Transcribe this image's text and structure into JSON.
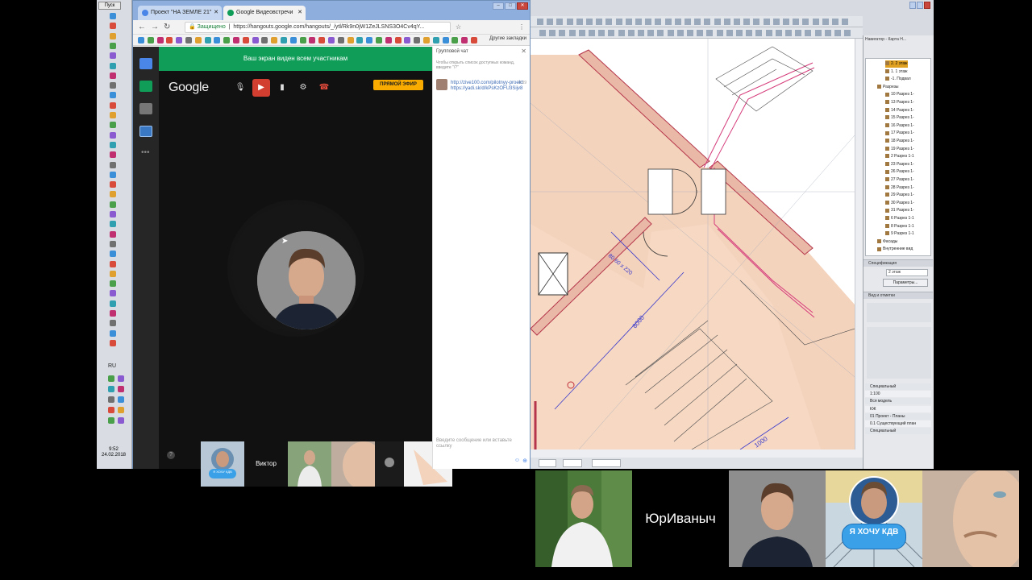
{
  "taskbar": {
    "start_label": "Пуск",
    "lang": "RU",
    "clock_time": "9:52",
    "clock_date": "24.02.2018"
  },
  "browser": {
    "tabs": [
      {
        "label": "Проект \"НА ЗЕМЛЕ 21\"",
        "favicon_color": "#4a86e8"
      },
      {
        "label": "Google Видеовстречи",
        "favicon_color": "#0f9d58"
      }
    ],
    "address_secure_label": "Защищено",
    "address_url": "https://hangouts.google.com/hangouts/_/ytl/Rk9n0jW1ZeJLSNS3O4Cv4qY...",
    "bookmarks_other_label": "Другие закладки"
  },
  "hangout": {
    "banner_text": "Ваш экран виден всем участникам",
    "logo_text": "Google",
    "live_button_label": "ПРЯМОЙ ЭФИР",
    "help_label": "?",
    "filmstrip": [
      {
        "kind": "kdv-badge",
        "badge_text": "Я ХОЧУ КДВ"
      },
      {
        "kind": "name",
        "name": "Виктор"
      },
      {
        "kind": "person"
      },
      {
        "kind": "face"
      },
      {
        "kind": "screen"
      }
    ]
  },
  "chat": {
    "title": "Групповой чат",
    "close_glyph": "✕",
    "hint": "Чтобы открыть список доступных команд, введите \"/?\"",
    "message_time": "8:39",
    "message_text": "http://zive100.com/pilotnyy-proekt https://yadi.sk/d/kPsKzOFU3Sijv8",
    "input_placeholder": "Введите сообщение или вставьте ссылку",
    "emoji_glyph": "☺",
    "attach_glyph": "⊕"
  },
  "cad": {
    "dimension_labels": [
      "80 60 x 220",
      "8000",
      "1000"
    ],
    "status_fields": [
      "",
      "",
      ""
    ],
    "navigator": {
      "title": "Навигатор - Карта Н...",
      "tree": [
        {
          "label": "2. 2 этаж",
          "highlight": true
        },
        {
          "label": "1. 1 этаж",
          "highlight": false
        },
        {
          "label": "-1. Подвал",
          "highlight": false
        },
        {
          "label": "Разрезы",
          "highlight": false
        },
        {
          "label": "10 Разрез 1-",
          "highlight": false
        },
        {
          "label": "13 Разрез 1-",
          "highlight": false
        },
        {
          "label": "14 Разрез 1-",
          "highlight": false
        },
        {
          "label": "15 Разрез 1-",
          "highlight": false
        },
        {
          "label": "16 Разрез 1-",
          "highlight": false
        },
        {
          "label": "17 Разрез 1-",
          "highlight": false
        },
        {
          "label": "18 Разрез 1-",
          "highlight": false
        },
        {
          "label": "19 Разрез 1-",
          "highlight": false
        },
        {
          "label": "2 Разрез 1-1",
          "highlight": false
        },
        {
          "label": "23 Разрез 1-",
          "highlight": false
        },
        {
          "label": "26 Разрез 1-",
          "highlight": false
        },
        {
          "label": "27 Разрез 1-",
          "highlight": false
        },
        {
          "label": "28 Разрез 1-",
          "highlight": false
        },
        {
          "label": "29 Разрез 1-",
          "highlight": false
        },
        {
          "label": "30 Разрез 1-",
          "highlight": false
        },
        {
          "label": "31 Разрез 1-",
          "highlight": false
        },
        {
          "label": "6 Разрез 1-1",
          "highlight": false
        },
        {
          "label": "8 Разрез 1-1",
          "highlight": false
        },
        {
          "label": "9 Разрез 1-1",
          "highlight": false
        },
        {
          "label": "Фасады",
          "highlight": false
        },
        {
          "label": "Внутренние вид",
          "highlight": false
        }
      ],
      "spec_label": "Спецификация",
      "spec_field": "2 этаж",
      "params_button": "Параметры...",
      "view_panel_label": "Вид и отметки",
      "layer_rows": [
        "Специальный",
        "1:100",
        "Вся модель",
        "КЖ",
        "01 Проект - Планы",
        "0.1 Существующий план",
        "Специальный"
      ]
    }
  },
  "participants": {
    "name_tile": "ЮрИваныч",
    "kdv_badge": "Я ХОЧУ КДВ"
  }
}
